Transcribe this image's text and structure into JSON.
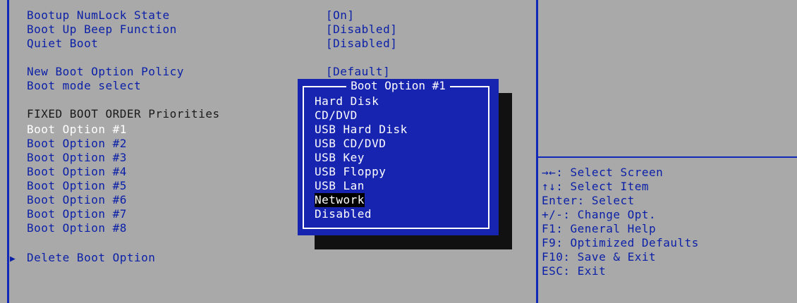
{
  "settings": [
    {
      "label": "Bootup NumLock State",
      "value": "[On]"
    },
    {
      "label": "Boot Up Beep Function",
      "value": "[Disabled]"
    },
    {
      "label": "Quiet Boot",
      "value": "[Disabled]"
    },
    {
      "label": "New Boot Option Policy",
      "value": "[Default]"
    },
    {
      "label": "Boot mode select",
      "value": ""
    }
  ],
  "fixed_order": {
    "heading": "FIXED BOOT ORDER Priorities",
    "options": [
      "Boot Option #1",
      "Boot Option #2",
      "Boot Option #3",
      "Boot Option #4",
      "Boot Option #5",
      "Boot Option #6",
      "Boot Option #7",
      "Boot Option #8"
    ],
    "selected_index": 0
  },
  "delete_boot_option": {
    "arrow": "▶",
    "label": "Delete Boot Option"
  },
  "popup": {
    "title": "Boot Option #1",
    "options": [
      "Hard Disk",
      "CD/DVD",
      "USB Hard Disk",
      "USB CD/DVD",
      "USB Key",
      "USB Floppy",
      "USB Lan",
      "Network",
      "Disabled"
    ],
    "highlighted": "Network"
  },
  "help": [
    "→←: Select Screen",
    "↑↓: Select Item",
    "Enter: Select",
    "+/-: Change Opt.",
    "F1: General Help",
    "F9: Optimized Defaults",
    "F10: Save & Exit",
    "ESC: Exit"
  ],
  "colors": {
    "background": "#a9a9a9",
    "text": "#0a1fa8",
    "popup": "#1624b0",
    "selected": "#ffffff"
  }
}
